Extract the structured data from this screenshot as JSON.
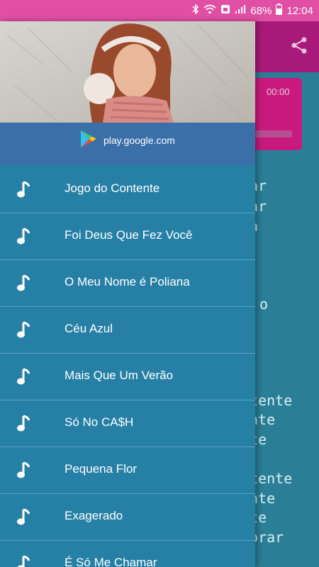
{
  "status_bar": {
    "battery": "68%",
    "time": "12:04"
  },
  "player": {
    "time": "00:00"
  },
  "lyrics_fragments": [
    "ar",
    "nar",
    "na",
    "o",
    "ntente",
    "ente",
    "nte",
    "ntente",
    "ente",
    "nte",
    "morar"
  ],
  "drawer": {
    "store_link": "play.google.com",
    "menu_items": [
      {
        "label": "Jogo do Contente",
        "icon": "music-note-icon"
      },
      {
        "label": "Foi Deus Que Fez Você",
        "icon": "music-note-icon"
      },
      {
        "label": "O Meu Nome é Poliana",
        "icon": "music-note-icon"
      },
      {
        "label": "Céu Azul",
        "icon": "music-note-icon"
      },
      {
        "label": "Mais Que Um Verão",
        "icon": "music-note-icon"
      },
      {
        "label": "Só No CA$H",
        "icon": "music-note-icon"
      },
      {
        "label": "Pequena Flor",
        "icon": "music-note-icon"
      },
      {
        "label": "Exagerado",
        "icon": "music-note-icon"
      },
      {
        "label": "É Só Me Chamar",
        "icon": "music-note-icon"
      }
    ]
  },
  "colors": {
    "status_bar": "#e04fa4",
    "app_bar": "#a9197a",
    "drawer": "#2680a6",
    "content": "#2a7f97"
  }
}
